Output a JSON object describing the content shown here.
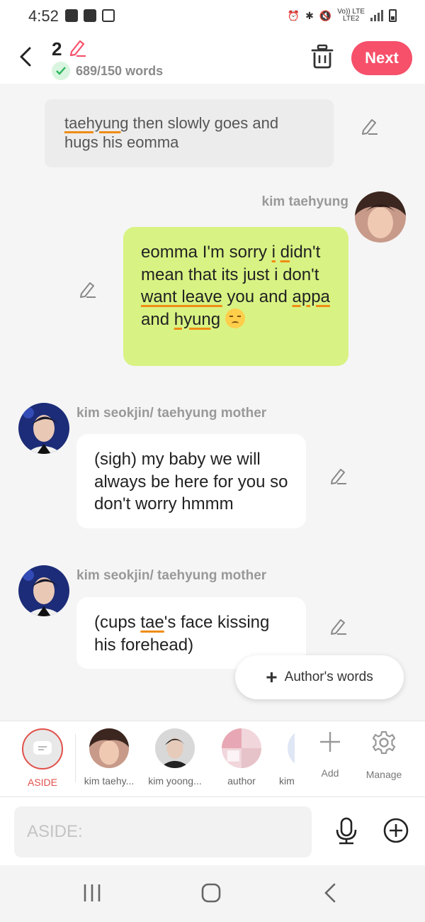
{
  "status_bar": {
    "time": "4:52",
    "network_top": "Vo)) LTE",
    "network_bottom": "LTE2"
  },
  "header": {
    "chapter_number": "2",
    "word_count": "689/150 words",
    "next_label": "Next"
  },
  "messages": [
    {
      "type": "narration",
      "text_parts": [
        "taehyung",
        " then slowly goes and hugs his eomma"
      ]
    },
    {
      "type": "self",
      "sender": "kim taehyung",
      "text_parts": [
        "eomma I'm sorry ",
        "i",
        " ",
        "d",
        "idn't mean that its just i don't ",
        "want leave",
        " you and ",
        "appa",
        " and ",
        "hyung"
      ]
    },
    {
      "type": "other",
      "sender": "kim seokjin/ taehyung mother",
      "text": "(sigh) my baby we will always be here for you so don't worry hmmm"
    },
    {
      "type": "other",
      "sender": "kim seokjin/ taehyung mother",
      "text_parts": [
        "(cups ",
        "tae",
        "'s face kissing his forehead)"
      ]
    }
  ],
  "authors_words_label": "Author's words",
  "characters": [
    {
      "label": "ASIDE"
    },
    {
      "label": "kim taehy..."
    },
    {
      "label": "kim yoong..."
    },
    {
      "label": "author"
    },
    {
      "label": "kim"
    }
  ],
  "tools": {
    "add_label": "Add",
    "manage_label": "Manage"
  },
  "input": {
    "placeholder": "ASIDE:"
  },
  "colors": {
    "accent": "#f6506a",
    "self_bubble": "#d8f383",
    "underline": "#f08c14"
  }
}
